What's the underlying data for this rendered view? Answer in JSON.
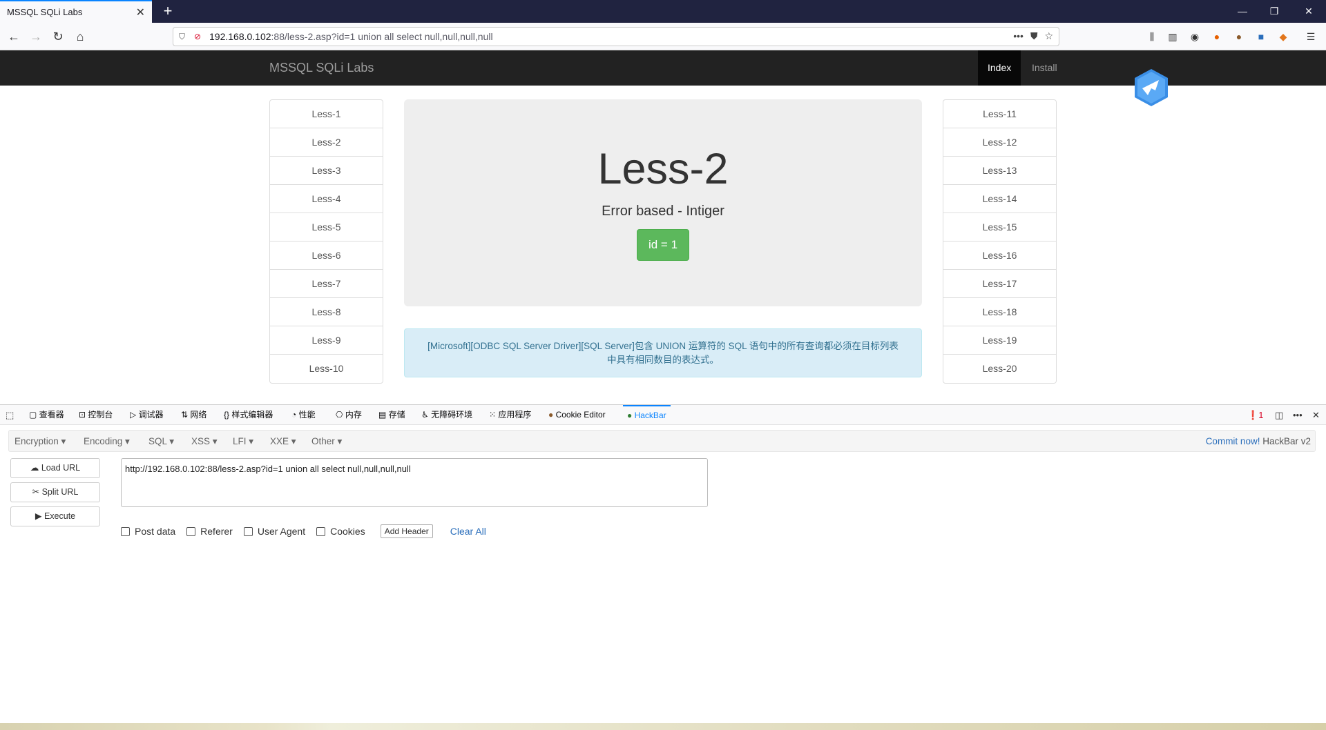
{
  "browser": {
    "tab_title": "MSSQL SQLi Labs",
    "tab_close": "✕",
    "new_tab": "+",
    "url_host": "192.168.0.102",
    "url_rest": ":88/less-2.asp?id=1 union all select null,null,null,null",
    "window_controls": [
      "—",
      "❐",
      "✕"
    ]
  },
  "site": {
    "brand": "MSSQL SQLi Labs",
    "nav": [
      "Index",
      "Install"
    ],
    "left_list": [
      "Less-1",
      "Less-2",
      "Less-3",
      "Less-4",
      "Less-5",
      "Less-6",
      "Less-7",
      "Less-8",
      "Less-9",
      "Less-10"
    ],
    "right_list": [
      "Less-11",
      "Less-12",
      "Less-13",
      "Less-14",
      "Less-15",
      "Less-16",
      "Less-17",
      "Less-18",
      "Less-19",
      "Less-20"
    ],
    "heading": "Less-2",
    "subheading": "Error based - Intiger",
    "id_button": "id = 1",
    "error_line1": "[Microsoft][ODBC SQL Server Driver][SQL Server]包含 UNION 运算符的 SQL 语句中的所有查询都必须在目标列表",
    "error_line2": "中具有相同数目的表达式。"
  },
  "devtools": {
    "tabs": [
      "查看器",
      "控制台",
      "调试器",
      "网络",
      "样式编辑器",
      "性能",
      "内存",
      "存储",
      "无障碍环境",
      "应用程序",
      "Cookie Editor",
      "HackBar"
    ],
    "active_tab": "HackBar",
    "error_count": "1"
  },
  "hackbar": {
    "menus": [
      "Encryption",
      "Encoding",
      "SQL",
      "XSS",
      "LFI",
      "XXE",
      "Other"
    ],
    "commit_link": "Commit now!",
    "commit_version": "HackBar v2",
    "buttons": [
      "Load URL",
      "Split URL",
      "Execute"
    ],
    "url_value": "http://192.168.0.102:88/less-2.asp?id=1 union all select null,null,null,null",
    "options": [
      "Post data",
      "Referer",
      "User Agent",
      "Cookies"
    ],
    "add_header": "Add Header",
    "clear_all": "Clear All"
  },
  "colors": {
    "accent": "#0a84ff",
    "success": "#5cb85c",
    "info_bg": "#d9edf7",
    "info_text": "#31708f",
    "navbar": "#222222"
  }
}
